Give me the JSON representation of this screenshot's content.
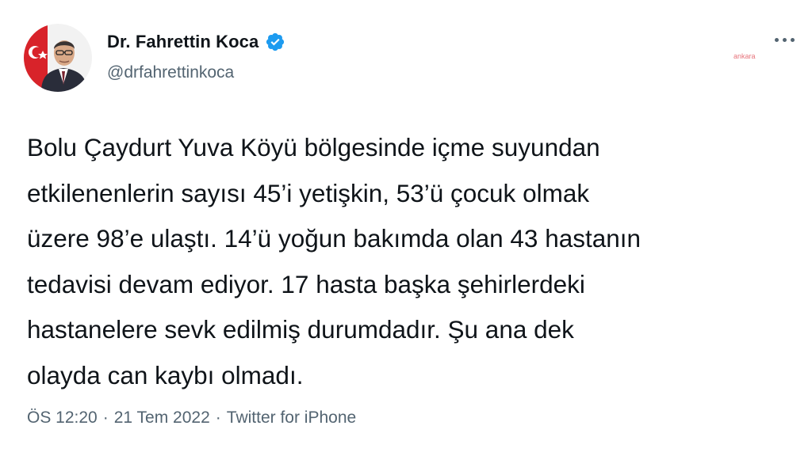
{
  "author": {
    "display_name": "Dr. Fahrettin Koca",
    "handle": "@drfahrettinkoca",
    "verified": true,
    "avatar_icon": "profile-photo"
  },
  "menu": {
    "icon": "more-options-icon"
  },
  "tweet": {
    "text": "Bolu Çaydurt Yuva Köyü bölgesinde içme suyundan\netkilenenlerin sayısı 45’i yetişkin, 53’ü çocuk olmak\nüzere 98’e ulaştı. 14’ü yoğun bakımda olan 43 hastanın\ntedavisi devam ediyor. 17 hasta başka şehirlerdeki\nhastanelere sevk edilmiş durumdadır. Şu ana dek\nolayda can kaybı olmadı.",
    "time": "ÖS 12:20",
    "separator": "·",
    "date": "21 Tem 2022",
    "source": "Twitter for iPhone"
  },
  "watermark": "ankara",
  "colors": {
    "verified_blue": "#1d9bf0",
    "secondary_text": "#536471",
    "primary_text": "#0f1419"
  }
}
